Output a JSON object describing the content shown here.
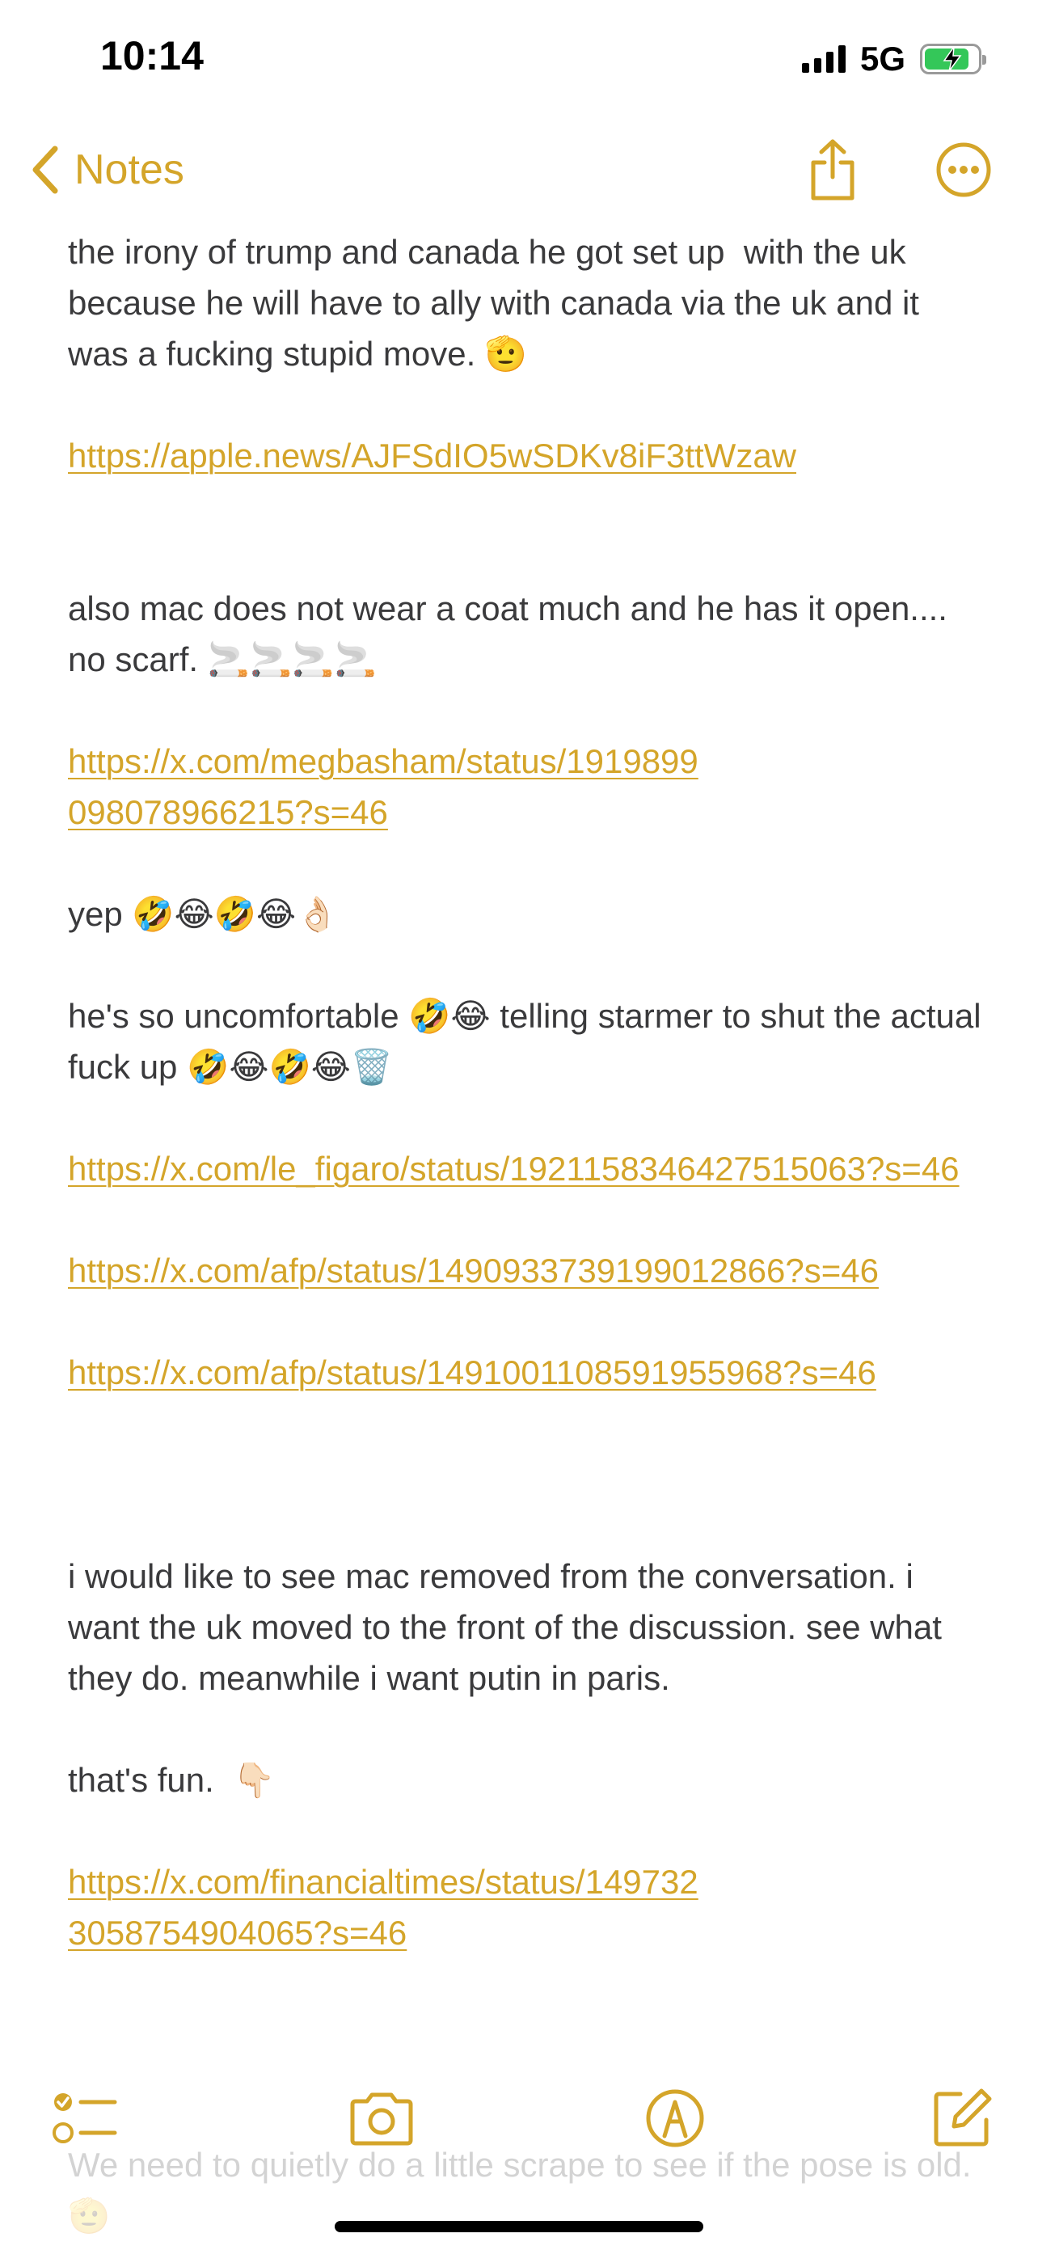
{
  "status_bar": {
    "time": "10:14",
    "network": "5G",
    "battery_percent": 85,
    "battery_charging": true,
    "icons": [
      "signal-icon",
      "battery-icon",
      "bolt-icon"
    ]
  },
  "nav": {
    "back_label": "Notes",
    "icons": [
      "chevron-left-icon",
      "share-icon",
      "more-icon"
    ],
    "accent_color": "#d4a52a"
  },
  "note": {
    "p1": "the irony of trump and canada he got set up  with the uk because he will have to ally with canada via the uk and it was a fucking stupid move. 🫡",
    "link1": "https://apple.news/AJFSdIO5wSDKv8iF3ttWzaw",
    "p2": "also mac does not wear a coat much and he has it open.... no scarf. 🚬🚬🚬🚬",
    "link2": "https://x.com/megbasham/status/1919899098078966215?s=46",
    "p3": "yep 🤣😂🤣😂👌🏻",
    "p4": "he's so uncomfortable 🤣😂 telling starmer to shut the actual fuck up 🤣😂🤣😂🗑️",
    "link3": "https://x.com/le_figaro/status/1921158346427515063?s=46",
    "link4": "https://x.com/afp/status/1490933739199012866?s=46",
    "link5": "https://x.com/afp/status/1491001108591955968?s=46",
    "p5": "i would like to see mac removed from the conversation. i want the uk moved to the front of the discussion. see what they do. meanwhile i want putin in paris.",
    "p6": "that's fun.  👇🏻",
    "link6": "https://x.com/financialtimes/status/1497323058754904065?s=46",
    "faded_bottom": "We need to quietly do a little scrape to see if the pose is old. 🫡"
  },
  "toolbar": {
    "icons": [
      "checklist-icon",
      "camera-icon",
      "markup-icon",
      "compose-icon"
    ]
  },
  "colors": {
    "text": "#3a3a3c",
    "link": "#d4a52a",
    "background": "#ffffff"
  }
}
